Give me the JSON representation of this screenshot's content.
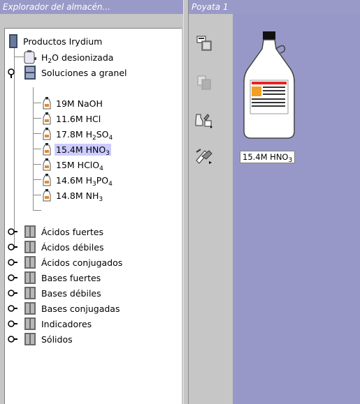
{
  "explorer": {
    "title": "Explorador del almacén...",
    "items": [
      {
        "label": "Productos Irydium"
      },
      {
        "label": "H₂O desionizada",
        "base": "H",
        "sub": "2",
        "rest": "O desionizada"
      },
      {
        "label": "Soluciones a granel"
      },
      {
        "label": "19M NaOH"
      },
      {
        "label": "11.6M HCl"
      },
      {
        "label": "17.8M H₂SO₄"
      },
      {
        "label": "15.4M HNO₃"
      },
      {
        "label": "15M HClO₄"
      },
      {
        "label": "14.6M H₃PO₄"
      },
      {
        "label": "14.8M NH₃"
      },
      {
        "label": "Ácidos fuertes"
      },
      {
        "label": "Ácidos débiles"
      },
      {
        "label": "Ácidos conjugados"
      },
      {
        "label": "Bases fuertes"
      },
      {
        "label": "Bases débiles"
      },
      {
        "label": "Bases conjugadas"
      },
      {
        "label": "Indicadores"
      },
      {
        "label": "Sólidos"
      }
    ],
    "selected_item": "15.4M HNO₃"
  },
  "bench": {
    "title": "Poyata 1",
    "bottle_label": "15.4M HNO₃",
    "tools": [
      "properties-icon",
      "copy-icon",
      "pour-icon",
      "remove-icon"
    ]
  },
  "colors": {
    "titlebar": "#9a9ac8",
    "workarea": "#9898c8",
    "selection": "#ccccff",
    "panel": "#c6c6c6"
  }
}
